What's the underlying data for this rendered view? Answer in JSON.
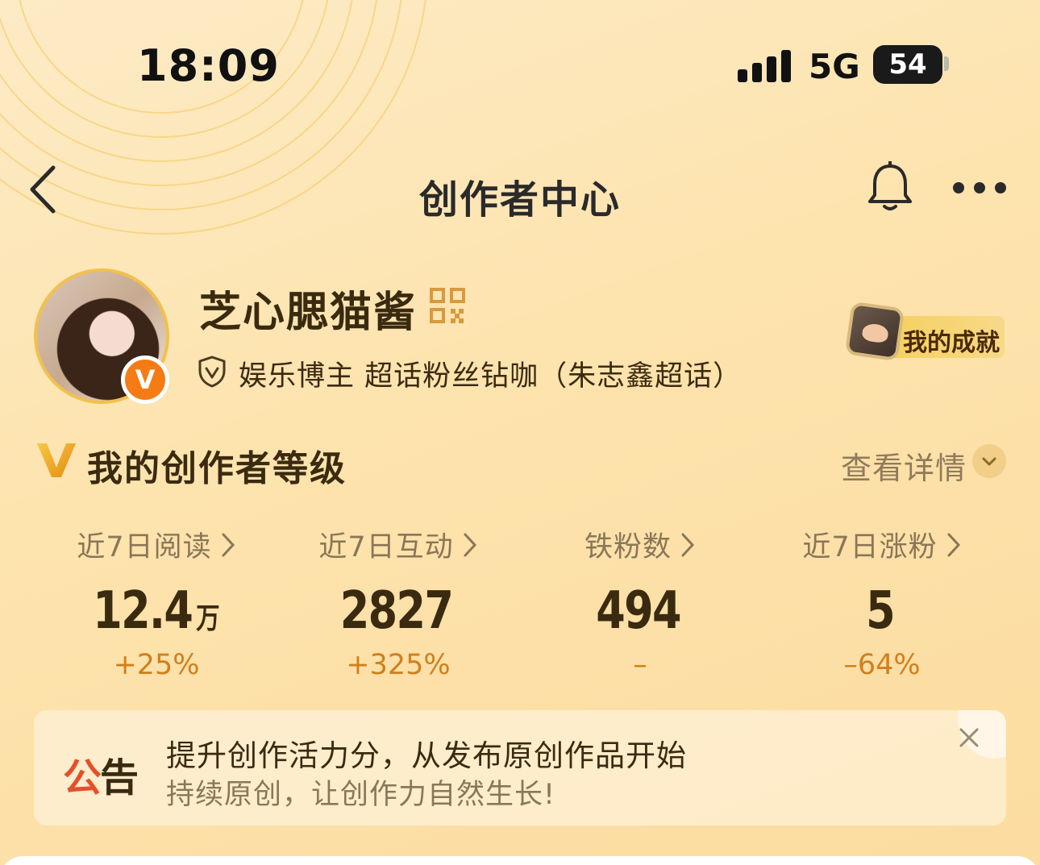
{
  "status_bar": {
    "time": "18:09",
    "network": "5G",
    "battery": "54",
    "battery_level": 0.54
  },
  "nav": {
    "title": "创作者中心",
    "back_icon": "chevron-left-icon",
    "bell_icon": "bell-icon",
    "more_icon": "more-dots-icon"
  },
  "profile": {
    "username": "芝心腮猫酱",
    "role": "娱乐博主 超话粉丝钻咖（朱志鑫超话）",
    "verified_badge": "V",
    "achievement_label": "我的成就",
    "accent_color": "#f57b14"
  },
  "level": {
    "title": "我的创作者等级",
    "details_link": "查看详情"
  },
  "stats": [
    {
      "label": "近7日阅读",
      "value": "12.4",
      "unit": "万",
      "change": "+25%"
    },
    {
      "label": "近7日互动",
      "value": "2827",
      "unit": "",
      "change": "+325%"
    },
    {
      "label": "铁粉数",
      "value": "494",
      "unit": "",
      "change": "–"
    },
    {
      "label": "近7日涨粉",
      "value": "5",
      "unit": "",
      "change": "–64%"
    }
  ],
  "notice": {
    "tag_part1": "公",
    "tag_part2": "告",
    "title": "提升创作活力分，从发布原创作品开始",
    "subtitle": "持续原创，让创作力自然生长!"
  }
}
